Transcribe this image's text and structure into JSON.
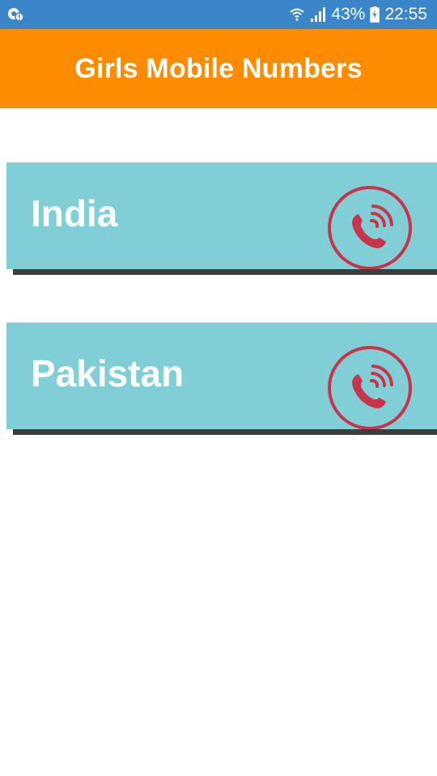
{
  "status_bar": {
    "battery_percent": "43%",
    "time": "22:55",
    "icons": [
      "notification-icon",
      "wifi-icon",
      "signal-icon",
      "battery-charging-icon"
    ]
  },
  "app_bar": {
    "title": "Girls Mobile Numbers"
  },
  "countries": [
    {
      "label": "India",
      "icon": "phone-call-icon"
    },
    {
      "label": "Pakistan",
      "icon": "phone-call-icon"
    }
  ],
  "colors": {
    "status_bar": "#3a86c8",
    "app_bar": "#ff8c00",
    "card": "#80ced6",
    "card_shadow": "#3d3d3d",
    "call_icon": "#c9344a"
  }
}
